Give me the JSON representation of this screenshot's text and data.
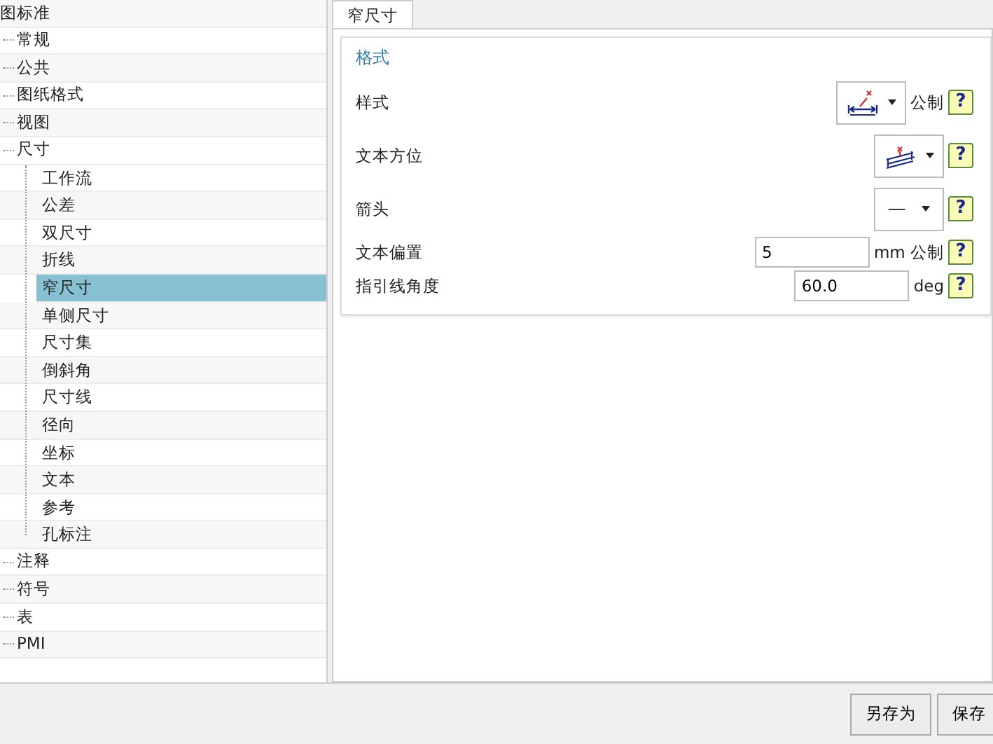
{
  "tree": {
    "label": "图标准",
    "selected": false,
    "children": [
      {
        "label": "常规",
        "selected": false
      },
      {
        "label": "公共",
        "selected": false
      },
      {
        "label": "图纸格式",
        "selected": false
      },
      {
        "label": "视图",
        "selected": false
      },
      {
        "label": "尺寸",
        "selected": false,
        "children": [
          {
            "label": "工作流",
            "selected": false
          },
          {
            "label": "公差",
            "selected": false
          },
          {
            "label": "双尺寸",
            "selected": false
          },
          {
            "label": "折线",
            "selected": false
          },
          {
            "label": "窄尺寸",
            "selected": true
          },
          {
            "label": "单侧尺寸",
            "selected": false
          },
          {
            "label": "尺寸集",
            "selected": false
          },
          {
            "label": "倒斜角",
            "selected": false
          },
          {
            "label": "尺寸线",
            "selected": false
          },
          {
            "label": "径向",
            "selected": false
          },
          {
            "label": "坐标",
            "selected": false
          },
          {
            "label": "文本",
            "selected": false
          },
          {
            "label": "参考",
            "selected": false
          },
          {
            "label": "孔标注",
            "selected": false
          }
        ]
      },
      {
        "label": "注释",
        "selected": false
      },
      {
        "label": "符号",
        "selected": false
      },
      {
        "label": "表",
        "selected": false
      },
      {
        "label": "PMI",
        "selected": false
      }
    ]
  },
  "tabs": [
    {
      "label": "窄尺寸",
      "selected": true
    }
  ],
  "group": {
    "title": "格式",
    "rows": [
      {
        "label": "样式",
        "kind": "style-select",
        "unit": "公制",
        "help": "?"
      },
      {
        "label": "文本方位",
        "kind": "orientation-select",
        "help": "?"
      },
      {
        "label": "箭头",
        "kind": "text-select",
        "value": "—",
        "help": "?"
      },
      {
        "label": "文本偏置",
        "kind": "number",
        "value": "5",
        "unit": "mm 公制",
        "help": "?"
      },
      {
        "label": "指引线角度",
        "kind": "number",
        "value": "60.0",
        "unit": "deg",
        "help": "?"
      }
    ]
  },
  "buttons": [
    "另存为",
    "保存"
  ]
}
